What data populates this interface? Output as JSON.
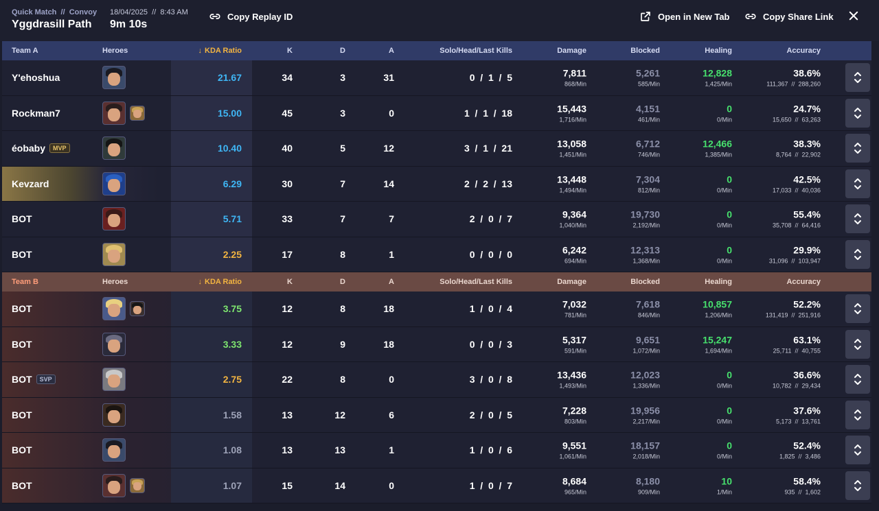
{
  "header": {
    "mode_line": "Quick Match  //  Convoy",
    "map_name": "Yggdrasill Path",
    "date_line": "18/04/2025  //  8:43 AM",
    "duration": "9m 10s",
    "copy_replay_label": "Copy Replay ID",
    "open_tab_label": "Open in New Tab",
    "copy_share_label": "Copy Share Link",
    "close_icon": "close-icon"
  },
  "columns": {
    "heroes": "Heroes",
    "kda": "KDA Ratio",
    "k": "K",
    "d": "D",
    "a": "A",
    "solo": "Solo/Head/Last Kills",
    "damage": "Damage",
    "blocked": "Blocked",
    "healing": "Healing",
    "accuracy": "Accuracy"
  },
  "colors": {
    "kda_blue": "#3fb6f5",
    "kda_green": "#7ee66f",
    "kda_gold": "#f2b441",
    "kda_grey": "#9ea3b8",
    "heal_green": "#47e06d",
    "team_b_label": "#ff9d7a"
  },
  "team_a": {
    "label": "Team A",
    "players": [
      {
        "name": "Y'ehoshua",
        "badge": "",
        "kda": "21.67",
        "kda_color": "blue",
        "k": "34",
        "d": "3",
        "a": "31",
        "solo": "0  /  1  /  5",
        "damage": "7,811",
        "damage_min": "868/Min",
        "blocked": "5,261",
        "blocked_min": "585/Min",
        "healing": "12,828",
        "healing_min": "1,425/Min",
        "accuracy": "38.6%",
        "accuracy_detail": "111,367  //  288,260",
        "hero_count": 1
      },
      {
        "name": "Rockman7",
        "badge": "",
        "kda": "15.00",
        "kda_color": "blue",
        "k": "45",
        "d": "3",
        "a": "0",
        "solo": "1  /  1  /  18",
        "damage": "15,443",
        "damage_min": "1,716/Min",
        "blocked": "4,151",
        "blocked_min": "461/Min",
        "healing": "0",
        "healing_min": "0/Min",
        "accuracy": "24.7%",
        "accuracy_detail": "15,650  //  63,263",
        "hero_count": 2
      },
      {
        "name": "éobaby",
        "badge": "MVP",
        "kda": "10.40",
        "kda_color": "blue",
        "k": "40",
        "d": "5",
        "a": "12",
        "solo": "3  /  1  /  21",
        "damage": "13,058",
        "damage_min": "1,451/Min",
        "blocked": "6,712",
        "blocked_min": "746/Min",
        "healing": "12,466",
        "healing_min": "1,385/Min",
        "accuracy": "38.3%",
        "accuracy_detail": "8,764  //  22,902",
        "hero_count": 1
      },
      {
        "name": "Kevzard",
        "badge": "",
        "kda": "6.29",
        "kda_color": "blue",
        "k": "30",
        "d": "7",
        "a": "14",
        "solo": "2  /  2  /  13",
        "damage": "13,448",
        "damage_min": "1,494/Min",
        "blocked": "7,304",
        "blocked_min": "812/Min",
        "healing": "0",
        "healing_min": "0/Min",
        "accuracy": "42.5%",
        "accuracy_detail": "17,033  //  40,036",
        "hero_count": 1
      },
      {
        "name": "BOT",
        "badge": "",
        "kda": "5.71",
        "kda_color": "blue",
        "k": "33",
        "d": "7",
        "a": "7",
        "solo": "2  /  0  /  7",
        "damage": "9,364",
        "damage_min": "1,040/Min",
        "blocked": "19,730",
        "blocked_min": "2,192/Min",
        "healing": "0",
        "healing_min": "0/Min",
        "accuracy": "55.4%",
        "accuracy_detail": "35,708  //  64,416",
        "hero_count": 1
      },
      {
        "name": "BOT",
        "badge": "",
        "kda": "2.25",
        "kda_color": "gold",
        "k": "17",
        "d": "8",
        "a": "1",
        "solo": "0  /  0  /  0",
        "damage": "6,242",
        "damage_min": "694/Min",
        "blocked": "12,313",
        "blocked_min": "1,368/Min",
        "healing": "0",
        "healing_min": "0/Min",
        "accuracy": "29.9%",
        "accuracy_detail": "31,096  //  103,947",
        "hero_count": 1
      }
    ]
  },
  "team_b": {
    "label": "Team B",
    "players": [
      {
        "name": "BOT",
        "badge": "",
        "kda": "3.75",
        "kda_color": "green",
        "k": "12",
        "d": "8",
        "a": "18",
        "solo": "1  /  0  /  4",
        "damage": "7,032",
        "damage_min": "781/Min",
        "blocked": "7,618",
        "blocked_min": "846/Min",
        "healing": "10,857",
        "healing_min": "1,206/Min",
        "accuracy": "52.2%",
        "accuracy_detail": "131,419  //  251,916",
        "hero_count": 2
      },
      {
        "name": "BOT",
        "badge": "",
        "kda": "3.33",
        "kda_color": "green",
        "k": "12",
        "d": "9",
        "a": "18",
        "solo": "0  /  0  /  3",
        "damage": "5,317",
        "damage_min": "591/Min",
        "blocked": "9,651",
        "blocked_min": "1,072/Min",
        "healing": "15,247",
        "healing_min": "1,694/Min",
        "accuracy": "63.1%",
        "accuracy_detail": "25,711  //  40,755",
        "hero_count": 1
      },
      {
        "name": "BOT",
        "badge": "SVP",
        "kda": "2.75",
        "kda_color": "gold",
        "k": "22",
        "d": "8",
        "a": "0",
        "solo": "3  /  0  /  8",
        "damage": "13,436",
        "damage_min": "1,493/Min",
        "blocked": "12,023",
        "blocked_min": "1,336/Min",
        "healing": "0",
        "healing_min": "0/Min",
        "accuracy": "36.6%",
        "accuracy_detail": "10,782  //  29,434",
        "hero_count": 1
      },
      {
        "name": "BOT",
        "badge": "",
        "kda": "1.58",
        "kda_color": "grey",
        "k": "13",
        "d": "12",
        "a": "6",
        "solo": "2  /  0  /  5",
        "damage": "7,228",
        "damage_min": "803/Min",
        "blocked": "19,956",
        "blocked_min": "2,217/Min",
        "healing": "0",
        "healing_min": "0/Min",
        "accuracy": "37.6%",
        "accuracy_detail": "5,173  //  13,761",
        "hero_count": 1
      },
      {
        "name": "BOT",
        "badge": "",
        "kda": "1.08",
        "kda_color": "grey",
        "k": "13",
        "d": "13",
        "a": "1",
        "solo": "1  /  0  /  6",
        "damage": "9,551",
        "damage_min": "1,061/Min",
        "blocked": "18,157",
        "blocked_min": "2,018/Min",
        "healing": "0",
        "healing_min": "0/Min",
        "accuracy": "52.4%",
        "accuracy_detail": "1,825  //  3,486",
        "hero_count": 1
      },
      {
        "name": "BOT",
        "badge": "",
        "kda": "1.07",
        "kda_color": "grey",
        "k": "15",
        "d": "14",
        "a": "0",
        "solo": "1  /  0  /  7",
        "damage": "8,684",
        "damage_min": "965/Min",
        "blocked": "8,180",
        "blocked_min": "909/Min",
        "healing": "10",
        "healing_min": "1/Min",
        "accuracy": "58.4%",
        "accuracy_detail": "935  //  1,602",
        "hero_count": 2
      }
    ]
  }
}
